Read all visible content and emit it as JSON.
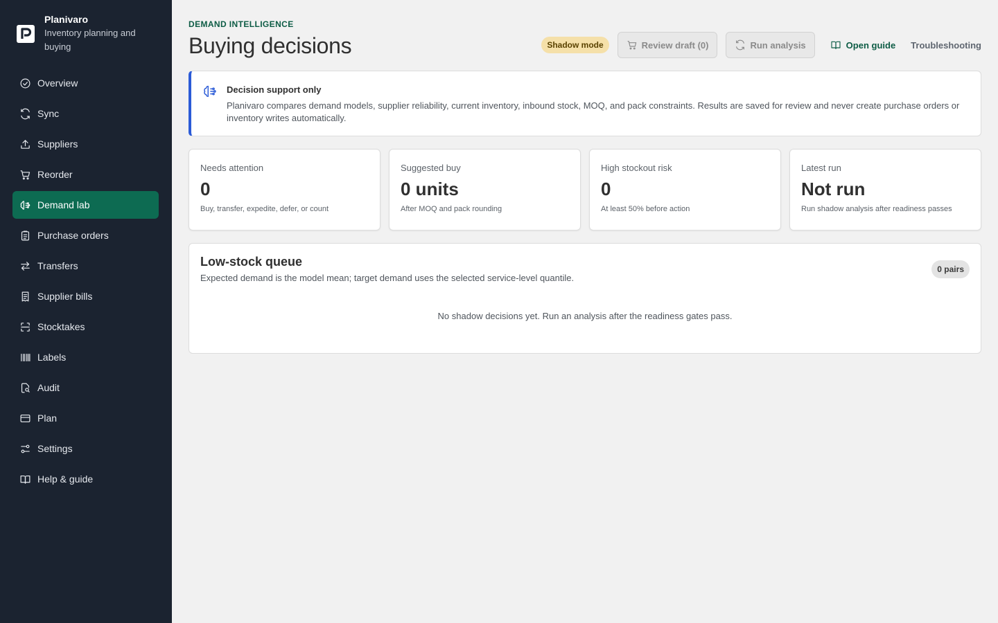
{
  "brand": {
    "name": "Planivaro",
    "subtitle": "Inventory planning and buying"
  },
  "nav": [
    {
      "label": "Overview",
      "icon": "check-circle-icon"
    },
    {
      "label": "Sync",
      "icon": "refresh-icon"
    },
    {
      "label": "Suppliers",
      "icon": "upload-icon"
    },
    {
      "label": "Reorder",
      "icon": "cart-icon"
    },
    {
      "label": "Demand lab",
      "icon": "brain-icon",
      "active": true
    },
    {
      "label": "Purchase orders",
      "icon": "clipboard-icon"
    },
    {
      "label": "Transfers",
      "icon": "arrows-exchange-icon"
    },
    {
      "label": "Supplier bills",
      "icon": "receipt-icon"
    },
    {
      "label": "Stocktakes",
      "icon": "scan-icon"
    },
    {
      "label": "Labels",
      "icon": "barcode-icon"
    },
    {
      "label": "Audit",
      "icon": "file-search-icon"
    },
    {
      "label": "Plan",
      "icon": "credit-card-icon"
    },
    {
      "label": "Settings",
      "icon": "sliders-icon"
    },
    {
      "label": "Help & guide",
      "icon": "book-icon"
    }
  ],
  "header": {
    "eyebrow": "DEMAND INTELLIGENCE",
    "title": "Buying decisions",
    "mode_badge": "Shadow mode",
    "review_label": "Review draft (0)",
    "run_label": "Run analysis",
    "guide_label": "Open guide",
    "troubleshooting_label": "Troubleshooting"
  },
  "banner": {
    "title": "Decision support only",
    "text": "Planivaro compares demand models, supplier reliability, current inventory, inbound stock, MOQ, and pack constraints. Results are saved for review and never create purchase orders or inventory writes automatically."
  },
  "stats": [
    {
      "label": "Needs attention",
      "value": "0",
      "sub": "Buy, transfer, expedite, defer, or count"
    },
    {
      "label": "Suggested buy",
      "value": "0 units",
      "sub": "After MOQ and pack rounding"
    },
    {
      "label": "High stockout risk",
      "value": "0",
      "sub": "At least 50% before action"
    },
    {
      "label": "Latest run",
      "value": "Not run",
      "sub": "Run shadow analysis after readiness passes"
    }
  ],
  "queue": {
    "title": "Low-stock queue",
    "subtitle": "Expected demand is the model mean; target demand uses the selected service-level quantile.",
    "badge": "0 pairs",
    "empty": "No shadow decisions yet. Run an analysis after the readiness gates pass."
  },
  "colors": {
    "sidebar_bg": "#1b2330",
    "accent": "#0d6b52",
    "info": "#2b5bd7",
    "badge_warn": "#f5e0a9"
  }
}
